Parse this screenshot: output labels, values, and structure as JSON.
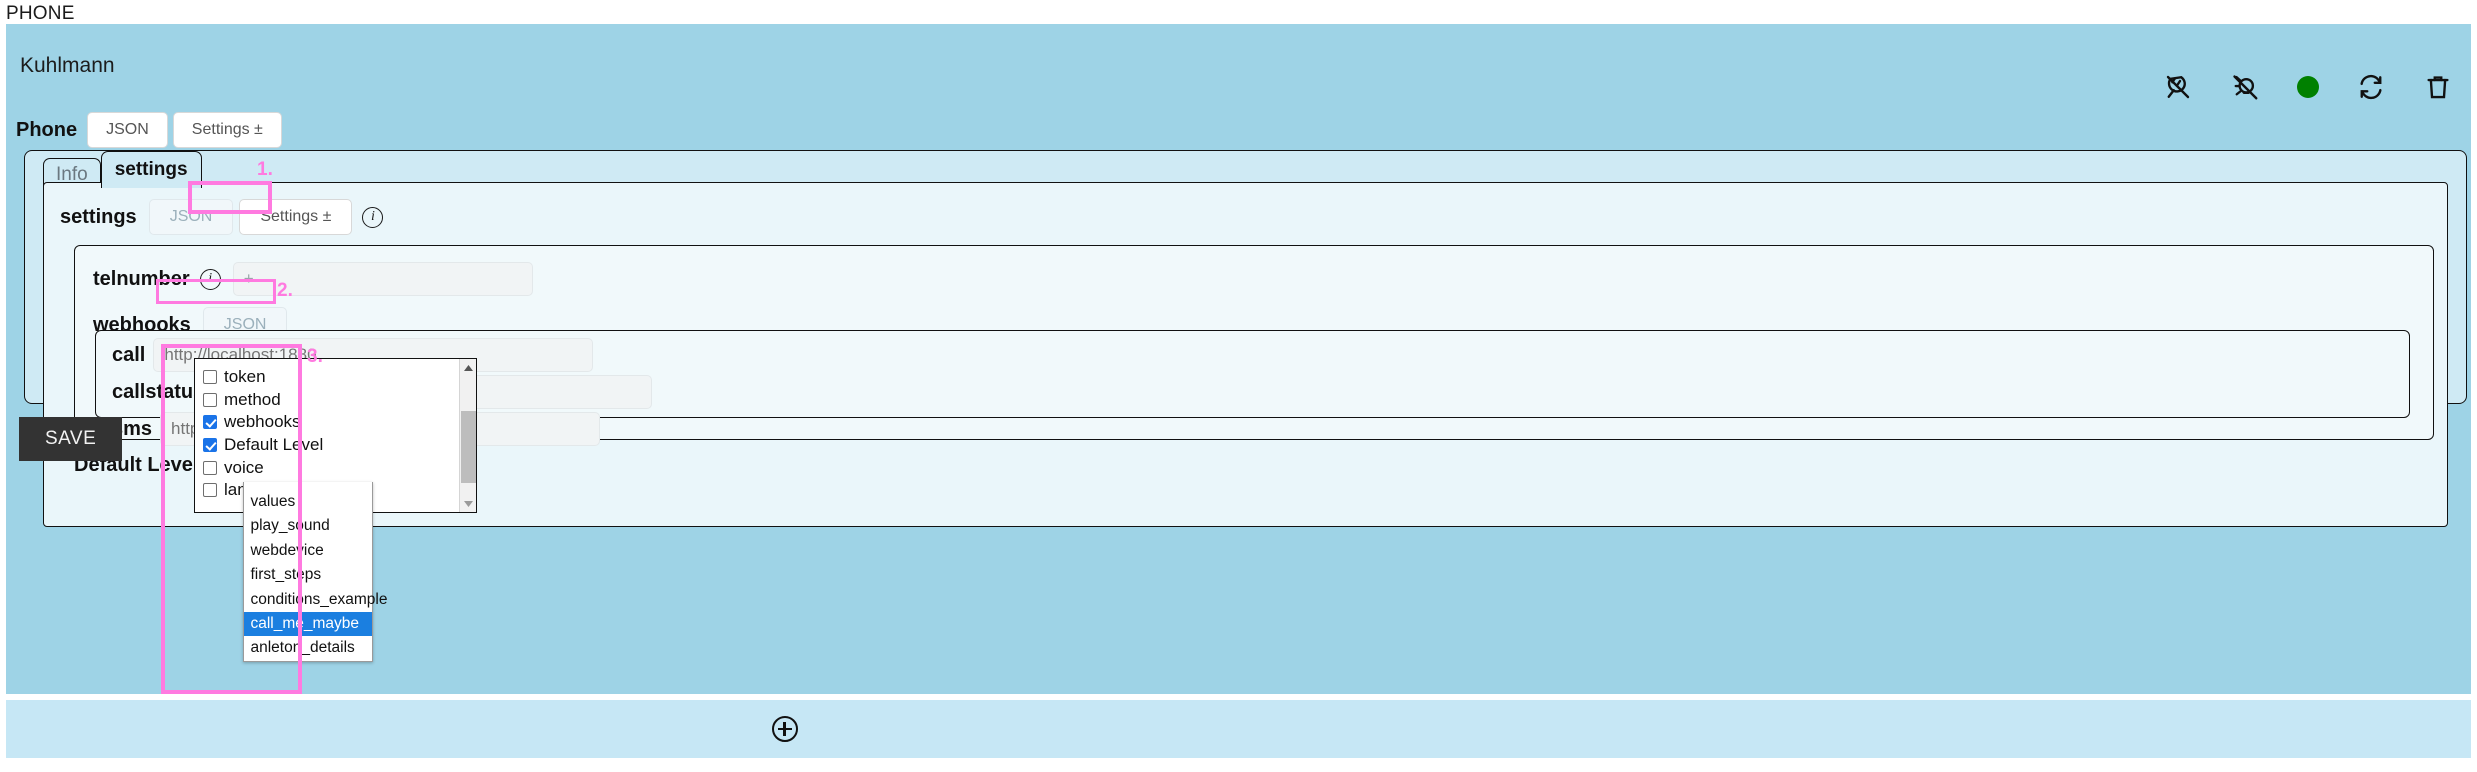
{
  "page": {
    "label": "PHONE"
  },
  "device": {
    "title": "Kuhlmann",
    "row_label": "Phone",
    "buttons": [
      {
        "label": "JSON",
        "name": "json-button"
      },
      {
        "label": "Settings ±",
        "name": "settings-button"
      }
    ],
    "icons": [
      {
        "name": "plug-off-icon",
        "title": "disconnect"
      },
      {
        "name": "lightbulb-off-icon",
        "title": "light off"
      },
      {
        "name": "status-dot-icon",
        "title": "online",
        "color": "#008000"
      },
      {
        "name": "refresh-icon",
        "title": "reload"
      },
      {
        "name": "trash-icon",
        "title": "delete"
      }
    ]
  },
  "tabs": [
    {
      "label": "Info",
      "active": false
    },
    {
      "label": "settings",
      "active": true
    }
  ],
  "settings": {
    "label": "settings",
    "json_label": "JSON",
    "settings_label": "Settings ±",
    "info_glyph": "i"
  },
  "fields": {
    "telnumber": {
      "label": "telnumber",
      "value": "+"
    },
    "webhooks": {
      "label": "webhooks",
      "json_label": "JSON"
    },
    "webhook_rows": [
      {
        "label": "call",
        "placeholder": "http://localhost:1880..."
      },
      {
        "label": "callstatus",
        "placeholder": "http://localhost:1880..."
      },
      {
        "label": "sms",
        "placeholder": "http://localhost:1880..."
      }
    ],
    "default_level": {
      "label": "Default Level"
    }
  },
  "checkbox_dropdown": {
    "items": [
      {
        "label": "token",
        "checked": false
      },
      {
        "label": "method",
        "checked": false
      },
      {
        "label": "webhooks",
        "checked": true
      },
      {
        "label": "Default Level",
        "checked": true
      },
      {
        "label": "voice",
        "checked": false
      },
      {
        "label": "language",
        "checked": false
      }
    ]
  },
  "select": {
    "value": "values",
    "options": [
      {
        "label": "values",
        "selected": false
      },
      {
        "label": "play_sound",
        "selected": false
      },
      {
        "label": "webdevice",
        "selected": false
      },
      {
        "label": "first_steps",
        "selected": false
      },
      {
        "label": "conditions_example",
        "selected": false
      },
      {
        "label": "call_me_maybe",
        "selected": true
      },
      {
        "label": "anleton_details",
        "selected": false
      }
    ]
  },
  "markers": [
    {
      "id": "1",
      "label": "1."
    },
    {
      "id": "2",
      "label": "2."
    },
    {
      "id": "3",
      "label": "3."
    }
  ],
  "actions": {
    "save_label": "SAVE",
    "add_label": "+"
  },
  "colors": {
    "panel": "#9ed3e6",
    "tab_card": "#cfeaf4",
    "settings_panel": "#eaf6fa",
    "field_box": "#f1f9fb",
    "highlight": "#ff7ae0",
    "selected_option": "#1b7fe0",
    "checkbox_on": "#1a73e8",
    "status": "#008000",
    "save": "#333333"
  }
}
